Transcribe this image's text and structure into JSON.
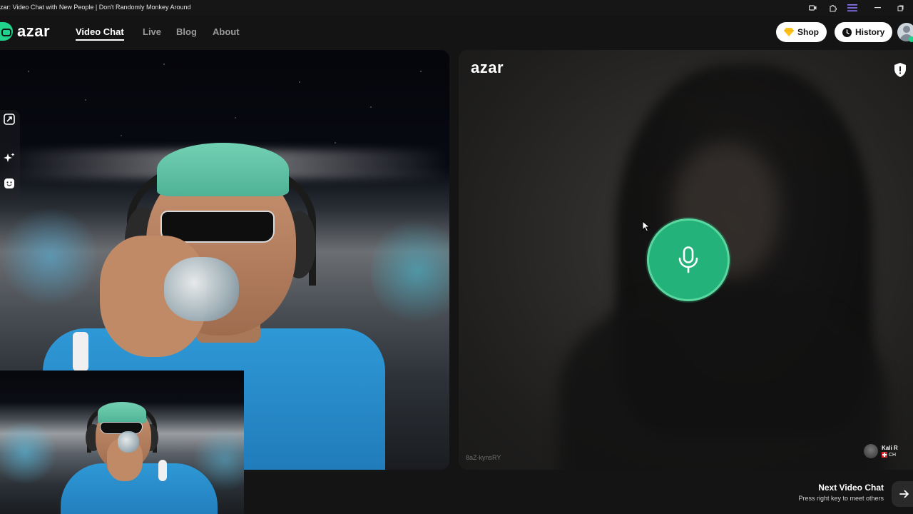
{
  "window": {
    "title": "zar: Video Chat with New People | Don't Randomly Monkey Around"
  },
  "nav": {
    "logo_text": "azar",
    "links": [
      {
        "label": "Video Chat",
        "active": true
      },
      {
        "label": "Live",
        "active": false
      },
      {
        "label": "Blog",
        "active": false
      },
      {
        "label": "About",
        "active": false
      }
    ],
    "shop_label": "Shop",
    "history_label": "History"
  },
  "side_tools": {
    "icons": [
      "expand-icon",
      "sparkle-effects-icon",
      "emoji-icon"
    ]
  },
  "partner_panel": {
    "logo_text": "azar",
    "user_id": "8aZ-kynsRY",
    "partner_name": "Kali R",
    "partner_country": "CH",
    "mic_icon": "microphone-icon",
    "report_icon": "shield-alert-icon"
  },
  "next_chat": {
    "title": "Next Video Chat",
    "subtitle": "Press right key to meet others"
  },
  "colors": {
    "accent_green": "#23b37a",
    "brand_green": "#22d48b",
    "background": "#141414"
  }
}
